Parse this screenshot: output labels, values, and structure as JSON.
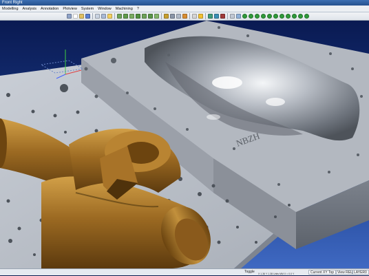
{
  "window": {
    "title": "Front Right"
  },
  "menubar": {
    "items": [
      "Modelling",
      "Analysis",
      "Annotation",
      "Plotview",
      "System",
      "Window",
      "Machining",
      "?"
    ]
  },
  "toolbar": {
    "icons": [
      {
        "name": "orient-icon",
        "color": "#8fa3c8"
      },
      {
        "name": "new-file-icon",
        "color": "#ffffff"
      },
      {
        "name": "open-icon",
        "color": "#e0c060"
      },
      {
        "name": "save-icon",
        "color": "#5a7fd0"
      },
      {
        "name": "sep"
      },
      {
        "name": "zoom-icon",
        "color": "#c9d3e2"
      },
      {
        "name": "rotate-icon",
        "color": "#a9b9d6"
      },
      {
        "name": "active-tool-icon",
        "color": "#f4d060"
      },
      {
        "name": "sep"
      },
      {
        "name": "view-front-icon",
        "color": "#6ea35a"
      },
      {
        "name": "view-top-icon",
        "color": "#5f9a4c"
      },
      {
        "name": "view-side-icon",
        "color": "#78ab60"
      },
      {
        "name": "view-iso-icon",
        "color": "#4f8e3f"
      },
      {
        "name": "view-right-icon",
        "color": "#6da158"
      },
      {
        "name": "view-left-icon",
        "color": "#5a9548"
      },
      {
        "name": "view-back-icon",
        "color": "#83b46a"
      },
      {
        "name": "sep"
      },
      {
        "name": "shade-icon",
        "color": "#c8a030"
      },
      {
        "name": "wireframe-icon",
        "color": "#8a96a8"
      },
      {
        "name": "hidden-line-icon",
        "color": "#b0bac8"
      },
      {
        "name": "render-icon",
        "color": "#d88d30"
      },
      {
        "name": "sep"
      },
      {
        "name": "layer-icon",
        "color": "#d4d4d4"
      },
      {
        "name": "highlight-icon",
        "color": "#f2c030"
      },
      {
        "name": "sep"
      },
      {
        "name": "curve-icon",
        "color": "#3f9a7a"
      },
      {
        "name": "surface-icon",
        "color": "#3a8fb5"
      },
      {
        "name": "solid-icon",
        "color": "#a03a3a"
      },
      {
        "name": "sep"
      },
      {
        "name": "pick-icon",
        "color": "#c0c8d4"
      },
      {
        "name": "measure-icon",
        "color": "#8fb0d8"
      },
      {
        "name": "green-ball-1-icon",
        "color": "#2f9a3a"
      },
      {
        "name": "green-ball-2-icon",
        "color": "#2f9a3a"
      },
      {
        "name": "green-ball-3-icon",
        "color": "#2f9a3a"
      },
      {
        "name": "green-ball-4-icon",
        "color": "#2f9a3a"
      },
      {
        "name": "green-ball-5-icon",
        "color": "#2f9a3a"
      },
      {
        "name": "green-ball-6-icon",
        "color": "#2f9a3a"
      },
      {
        "name": "green-ball-7-icon",
        "color": "#2f9a3a"
      },
      {
        "name": "green-ball-8-icon",
        "color": "#2f9a3a"
      },
      {
        "name": "green-ball-9-icon",
        "color": "#2f9a3a"
      },
      {
        "name": "green-ball-10-icon",
        "color": "#2f9a3a"
      },
      {
        "name": "green-ball-11-icon",
        "color": "#2f9a3a"
      }
    ]
  },
  "viewport": {
    "mold_engraving": "NBZH",
    "colors": {
      "plate": "#b8bdc5",
      "mold": "#9aa0a9",
      "bronze": "#9c6a22",
      "background_top": "#0a1a52",
      "background_bottom": "#3f69c2"
    }
  },
  "statusbar": {
    "toggle": "Toggle",
    "plane": "Current XY Top",
    "view": "View REL",
    "layer": "LAYER0",
    "coords": "X 1.36  Y 1.38",
    "units": "Units MM",
    "extra": "X = 0.0  Y"
  }
}
